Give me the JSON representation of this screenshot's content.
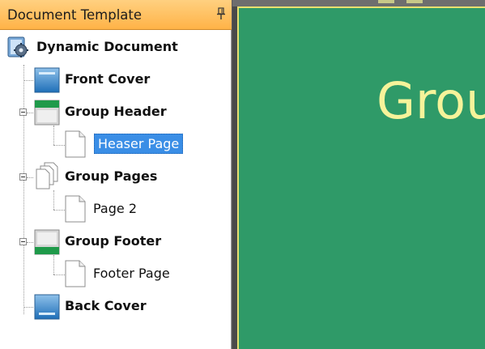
{
  "panel": {
    "title": "Document Template"
  },
  "tree": {
    "root": {
      "label": "Dynamic Document",
      "icon": "gear-document-icon"
    },
    "items": [
      {
        "label": "Front Cover",
        "icon": "front-cover-icon"
      },
      {
        "label": "Group Header",
        "icon": "group-header-icon"
      },
      {
        "label": "Heaser Page",
        "icon": "page-icon"
      },
      {
        "label": "Group Pages",
        "icon": "pages-stack-icon"
      },
      {
        "label": "Page 2",
        "icon": "page-icon"
      },
      {
        "label": "Group Footer",
        "icon": "group-footer-icon"
      },
      {
        "label": "Footer Page",
        "icon": "page-icon"
      },
      {
        "label": "Back Cover",
        "icon": "back-cover-icon"
      }
    ]
  },
  "preview": {
    "heading": "Grou",
    "page_color": "#2f9a68",
    "text_color": "#f6f39a"
  }
}
